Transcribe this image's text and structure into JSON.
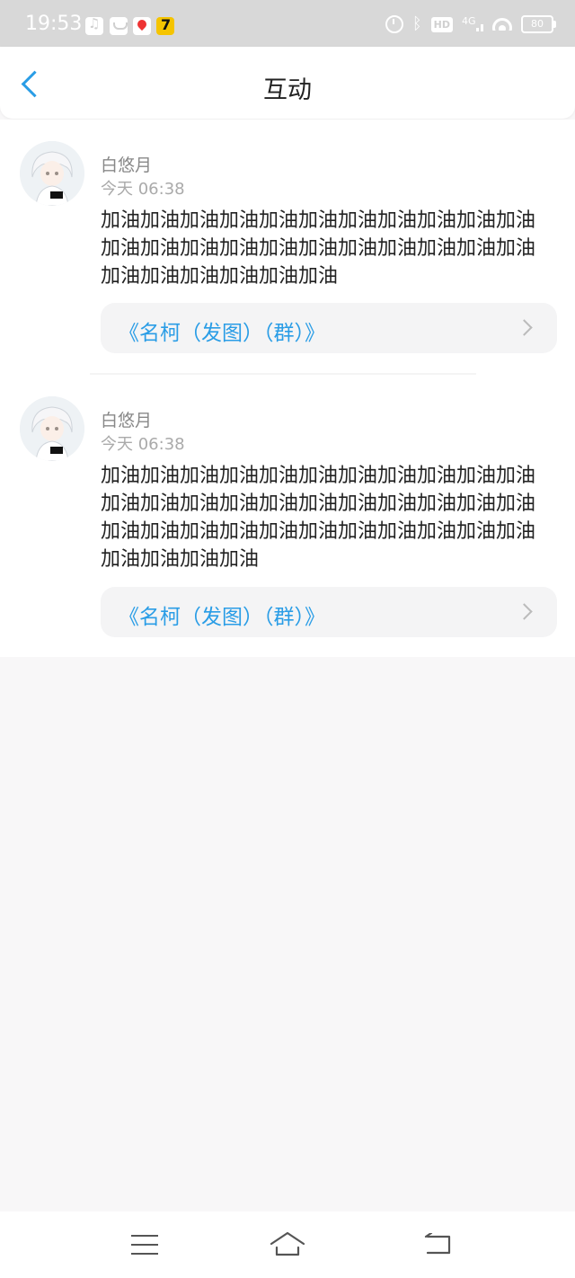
{
  "status_bar": {
    "time": "19:53",
    "network": "4G",
    "hd": "HD",
    "battery": "80",
    "icons": [
      "music-icon",
      "mail-icon",
      "map-icon",
      "cat-app-icon",
      "alarm-icon",
      "bluetooth-icon",
      "wifi-icon",
      "battery-icon"
    ]
  },
  "header": {
    "title": "互动",
    "back_icon": "chevron-left-icon"
  },
  "colors": {
    "accent": "#2a9de6",
    "background": "#f8f7f8",
    "card": "#f4f4f5"
  },
  "feed": {
    "items": [
      {
        "username": "白悠月",
        "time": "今天 06:38",
        "message": "加油加油加油加油加油加油加油加油加油加油加油加油加油加油加油加油加油加油加油加油加油加油加油加油加油加油加油加油",
        "link_text": "《名柯（发图）（群）》"
      },
      {
        "username": "白悠月",
        "time": "今天 06:38",
        "message": "加油加油加油加油加油加油加油加油加油加油加油加油加油加油加油加油加油加油加油加油加油加油加油加油加油加油加油加油加油加油加油加油加油加油加油加油加油",
        "link_text": "《名柯（发图）（群）》"
      }
    ]
  },
  "nav_bar": {
    "icons": [
      "menu-icon",
      "home-icon",
      "back-icon"
    ]
  }
}
